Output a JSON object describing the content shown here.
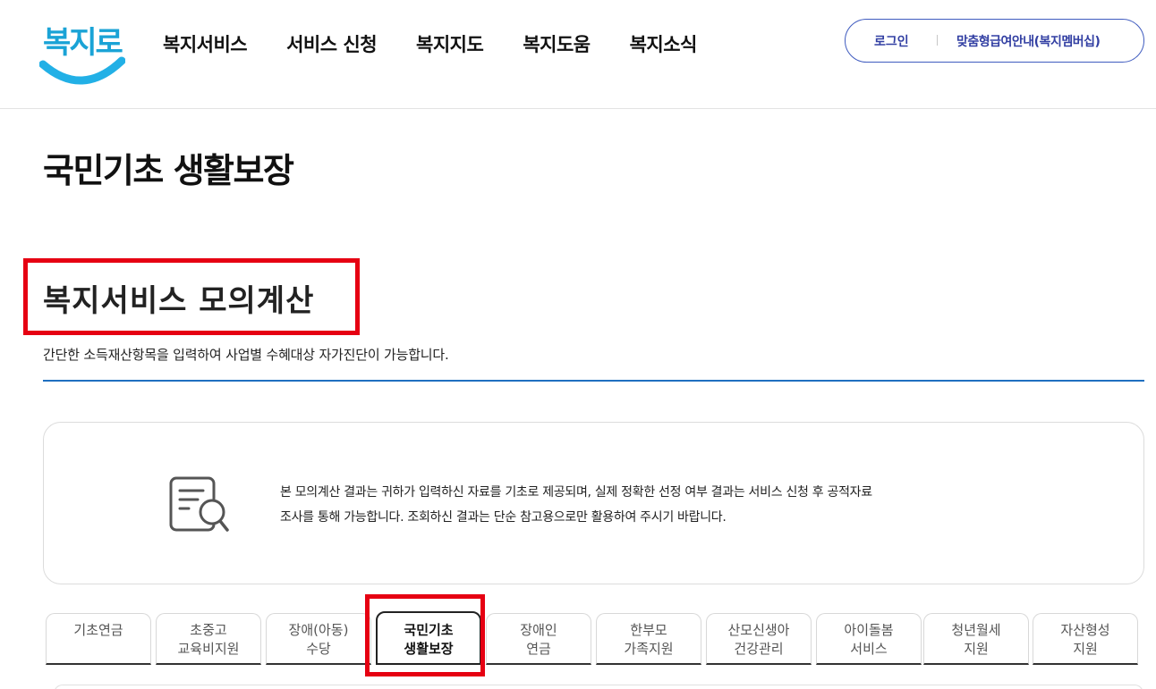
{
  "header": {
    "logo_text": "복지로",
    "logo_color": "#1aa3d6",
    "nav": [
      "복지서비스",
      "서비스 신청",
      "복지지도",
      "복지도움",
      "복지소식"
    ],
    "login_label": "로그인",
    "member_label": "맞춤형급여안내(복지멤버십)"
  },
  "page": {
    "title": "국민기초 생활보장",
    "section_title": "복지서비스 모의계산",
    "section_desc": "간단한 소득재산항목을 입력하여 사업별 수혜대상 자가진단이 가능합니다."
  },
  "notice": {
    "icon": "document-search-icon",
    "line1": "본 모의계산 결과는 귀하가 입력하신 자료를 기초로 제공되며, 실제 정확한 선정 여부 결과는 서비스 신청 후 공적자료",
    "line2": "조사를 통해 가능합니다. 조회하신 결과는 단순 참고용으로만 활용하여 주시기 바랍니다."
  },
  "tabs": [
    {
      "line1": "기초연금",
      "line2": ""
    },
    {
      "line1": "초중고",
      "line2": "교육비지원"
    },
    {
      "line1": "장애(아동)",
      "line2": "수당"
    },
    {
      "line1": "국민기초",
      "line2": "생활보장",
      "active": true
    },
    {
      "line1": "장애인",
      "line2": "연금"
    },
    {
      "line1": "한부모",
      "line2": "가족지원"
    },
    {
      "line1": "산모신생아",
      "line2": "건강관리"
    },
    {
      "line1": "아이돌봄",
      "line2": "서비스"
    },
    {
      "line1": "청년월세",
      "line2": "지원"
    },
    {
      "line1": "자산형성",
      "line2": "지원"
    }
  ],
  "colors": {
    "accent_blue": "#3f5bbf",
    "rule_blue": "#1f6fc0",
    "highlight_red": "#e60012"
  }
}
